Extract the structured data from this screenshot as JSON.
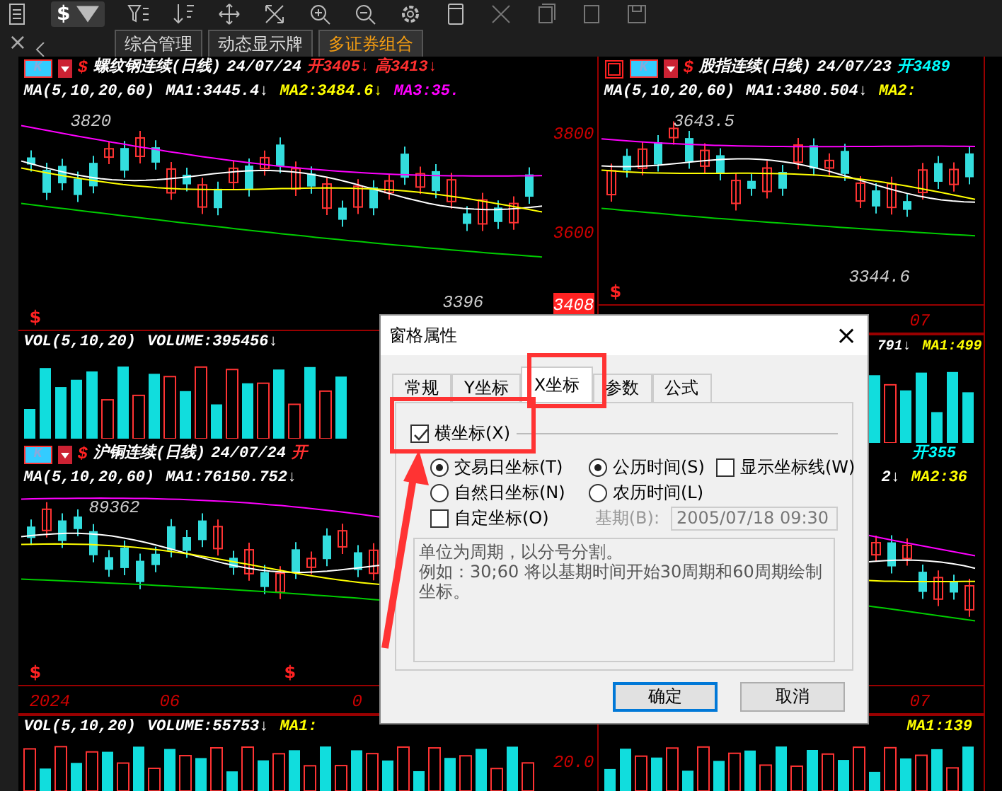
{
  "toolbar": {
    "currency": "$"
  },
  "sidebar": {
    "close": "×"
  },
  "tabs": [
    {
      "label": "综合管理",
      "selected": false
    },
    {
      "label": "动态显示牌",
      "selected": false
    },
    {
      "label": "多证券组合",
      "selected": true
    }
  ],
  "panels": [
    {
      "period": "K",
      "signal": "$",
      "title": "螺纹钢连续(日线)",
      "date": "24/07/24",
      "quotes": [
        {
          "text": "开3405↓",
          "color": "#ff3030"
        },
        {
          "text": "高3413↓",
          "color": "#ff3030"
        }
      ],
      "ma": {
        "label": "MA(5,10,20,60)",
        "values": [
          {
            "text": "MA1:3445.4↓",
            "color": "#ffffff"
          },
          {
            "text": "MA2:3484.6↓",
            "color": "#ffff00"
          },
          {
            "text": "MA3:35.",
            "color": "#ff00ff"
          }
        ]
      },
      "high_label": "3820",
      "low_label": "3396",
      "axis_labels": [
        "3800",
        "3600"
      ],
      "last_price": "3408",
      "signals": [
        "$"
      ],
      "volume": {
        "label": "VOL(5,10,20)",
        "values": [
          {
            "text": "VOLUME:395456↓",
            "color": "#ffffff"
          }
        ]
      }
    },
    {
      "period": "K",
      "signal": "$",
      "title": "股指连续(日线)",
      "date": "24/07/23",
      "quotes": [
        {
          "text": "开3489",
          "color": "#00ffff"
        }
      ],
      "ma": {
        "label": "MA(5,10,20,60)",
        "values": [
          {
            "text": "MA1:3480.504↓",
            "color": "#ffffff"
          },
          {
            "text": "MA2:",
            "color": "#ffff00"
          }
        ]
      },
      "high_label": "3643.5",
      "low_label": "3344.6",
      "date_axis": [
        "07"
      ],
      "signals": [
        "$"
      ],
      "volume": {
        "values": [
          {
            "text": "791↓",
            "color": "#ffffff"
          },
          {
            "text": "MA1:499",
            "color": "#ffff00"
          }
        ]
      }
    },
    {
      "period": "K",
      "signal": "$",
      "title": "沪铜连续(日线)",
      "date": "24/07/24",
      "quotes": [
        {
          "text": "开",
          "color": "#ff3030"
        }
      ],
      "ma": {
        "label": "MA(5,10,20,60)",
        "values": [
          {
            "text": "MA1:76150.752↓",
            "color": "#ffffff"
          }
        ]
      },
      "high_label": "89362",
      "date_axis": [
        "2024",
        "06",
        "0"
      ],
      "signals": [
        "$",
        "$"
      ],
      "volume": {
        "label": "VOL(5,10,20)",
        "values": [
          {
            "text": "VOLUME:55753↓",
            "color": "#ffffff"
          },
          {
            "text": "MA1:",
            "color": "#ffff00"
          }
        ],
        "axis_label": "20.0"
      }
    },
    {
      "quotes": [
        {
          "text": "开355",
          "color": "#00ffff"
        }
      ],
      "ma": {
        "values": [
          {
            "text": "2↓",
            "color": "#ffffff"
          },
          {
            "text": "MA2:36",
            "color": "#ffff00"
          }
        ]
      },
      "date_axis": [
        "07"
      ],
      "volume": {
        "values": [
          {
            "text": "MA1:139",
            "color": "#ffff00"
          }
        ]
      }
    }
  ],
  "dialog": {
    "title": "窗格属性",
    "close": "×",
    "tabs": [
      {
        "label": "常规",
        "selected": false
      },
      {
        "label": "Y坐标",
        "selected": false
      },
      {
        "label": "X坐标",
        "selected": true
      },
      {
        "label": "参数",
        "selected": false
      },
      {
        "label": "公式",
        "selected": false
      }
    ],
    "group": {
      "label": "横坐标(X)",
      "checked": true
    },
    "options": [
      {
        "kind": "radio",
        "label": "交易日坐标(T)",
        "selected": true
      },
      {
        "kind": "radio",
        "label": "公历时间(S)",
        "selected": true
      },
      {
        "kind": "checkbox",
        "label": "显示坐标线(W)",
        "checked": false
      },
      {
        "kind": "radio",
        "label": "自然日坐标(N)",
        "selected": false
      },
      {
        "kind": "radio",
        "label": "农历时间(L)",
        "selected": false
      }
    ],
    "custom": {
      "label": "自定坐标(O)",
      "checked": false
    },
    "base_period": {
      "label": "基期(B):",
      "value": "2005/07/18 09:30",
      "disabled": true
    },
    "note": [
      "单位为周期，以分号分割。",
      "例如：30;60 将以基期时间开始30周期和60周期绘制坐标。"
    ],
    "buttons": [
      {
        "label": "确定",
        "default": true
      },
      {
        "label": "取消",
        "default": false
      }
    ]
  }
}
